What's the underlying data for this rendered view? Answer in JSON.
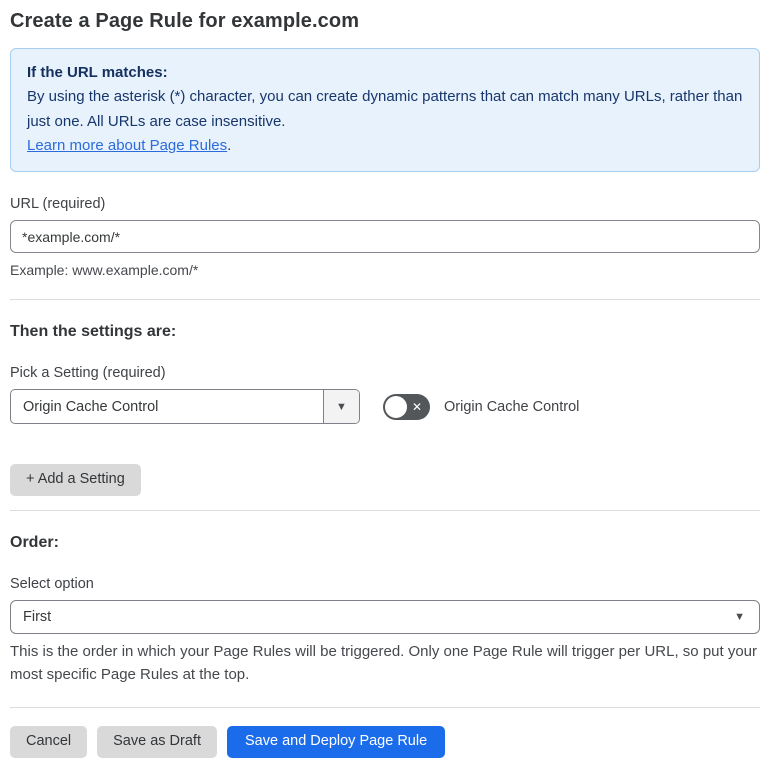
{
  "page": {
    "title": "Create a Page Rule for example.com"
  },
  "info_box": {
    "heading": "If the URL matches:",
    "body": "By using the asterisk (*) character, you can create dynamic patterns that can match many URLs, rather than just one. All URLs are case insensitive.",
    "link_label": "Learn more about Page Rules",
    "link_suffix": "."
  },
  "url_field": {
    "label": "URL (required)",
    "value": "*example.com/*",
    "helper": "Example: www.example.com/*"
  },
  "settings": {
    "heading": "Then the settings are:",
    "picker_label": "Pick a Setting (required)",
    "picker_value": "Origin Cache Control",
    "picker_arrow": "▼",
    "toggle_state": "off",
    "toggle_icon": "✕",
    "toggle_label": "Origin Cache Control",
    "add_button_label": "+ Add a Setting"
  },
  "order": {
    "heading": "Order:",
    "select_label": "Select option",
    "select_value": "First",
    "select_arrow": "▼",
    "helper": "This is the order in which your Page Rules will be triggered. Only one Page Rule will trigger per URL, so put your most specific Page Rules at the top."
  },
  "footer": {
    "cancel_label": "Cancel",
    "save_draft_label": "Save as Draft",
    "save_deploy_label": "Save and Deploy Page Rule"
  },
  "colors": {
    "accent_blue": "#1b6ceb",
    "info_background": "#e8f2fc",
    "info_border": "#a9cdf0",
    "info_text": "#17366b",
    "link_blue": "#2b6bdb",
    "toggle_off": "#54575a",
    "gray_button": "#d9d9d9",
    "divider": "#dcdcdc"
  }
}
